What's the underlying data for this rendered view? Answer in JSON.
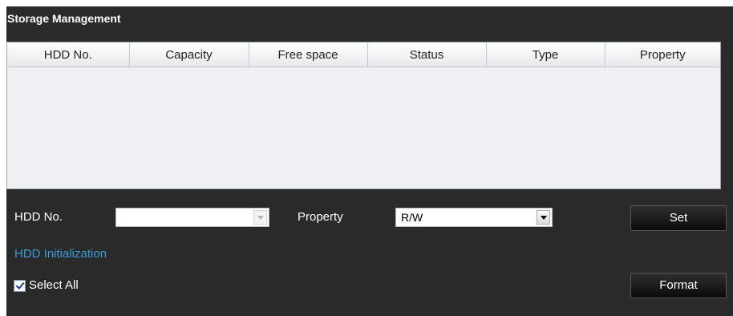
{
  "panel": {
    "title": "Storage Management"
  },
  "table": {
    "columns": [
      "HDD No.",
      "Capacity",
      "Free space",
      "Status",
      "Type",
      "Property"
    ],
    "rows": []
  },
  "form": {
    "hdd_no_label": "HDD No.",
    "hdd_no_value": "",
    "property_label": "Property",
    "property_value": "R/W",
    "set_button": "Set",
    "init_link": "HDD Initialization",
    "select_all_label": "Select All",
    "select_all_checked": true,
    "format_button": "Format"
  },
  "colors": {
    "panel_bg": "#2a2a2a",
    "link": "#3a9cd8",
    "table_bg": "#eef0f3"
  }
}
